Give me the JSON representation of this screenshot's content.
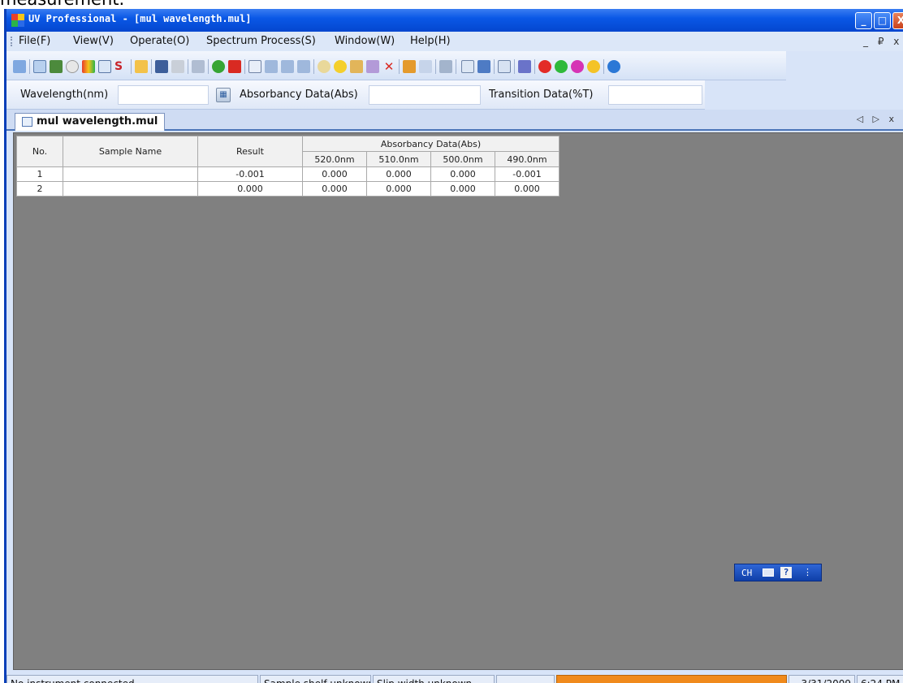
{
  "caption_fragment": "measurement.",
  "window": {
    "title": "UV Professional - [mul wavelength.mul]",
    "controls": [
      "_",
      "□",
      "X"
    ]
  },
  "menu": {
    "items": [
      "File(F)",
      "View(V)",
      "Operate(O)",
      "Spectrum Process(S)",
      "Window(W)",
      "Help(H)"
    ],
    "mdi_controls": "_ ₽ x"
  },
  "inputbar": {
    "wavelength_label": "Wavelength(nm)",
    "wavelength_value": "",
    "absorbancy_label": "Absorbancy Data(Abs)",
    "absorbancy_value": "",
    "transition_label": "Transition Data(%T)",
    "transition_value": ""
  },
  "document_tab": {
    "label": "mul wavelength.mul",
    "controls": "◁ ▷ x"
  },
  "table": {
    "headers": {
      "no": "No.",
      "sample_name": "Sample Name",
      "result": "Result",
      "group": "Absorbancy Data(Abs)",
      "wavelengths": [
        "520.0nm",
        "510.0nm",
        "500.0nm",
        "490.0nm"
      ]
    },
    "rows": [
      {
        "no": "1",
        "sample_name": "",
        "result": "-0.001",
        "values": [
          "0.000",
          "0.000",
          "0.000",
          "-0.001"
        ]
      },
      {
        "no": "2",
        "sample_name": "",
        "result": "0.000",
        "values": [
          "0.000",
          "0.000",
          "0.000",
          "0.000"
        ]
      }
    ]
  },
  "ime_bar": {
    "lang": "CH",
    "help": "?"
  },
  "status": {
    "instrument": "No instrument connected.",
    "shelf": "Sample shelf unknown",
    "slit": "Slip width unknown.",
    "date": "3/31/2009",
    "time": "6:24 PM"
  },
  "colors": {
    "title_blue": "#0a58e6",
    "mdi_gray": "#808080",
    "progress_orange": "#f08a1c"
  }
}
